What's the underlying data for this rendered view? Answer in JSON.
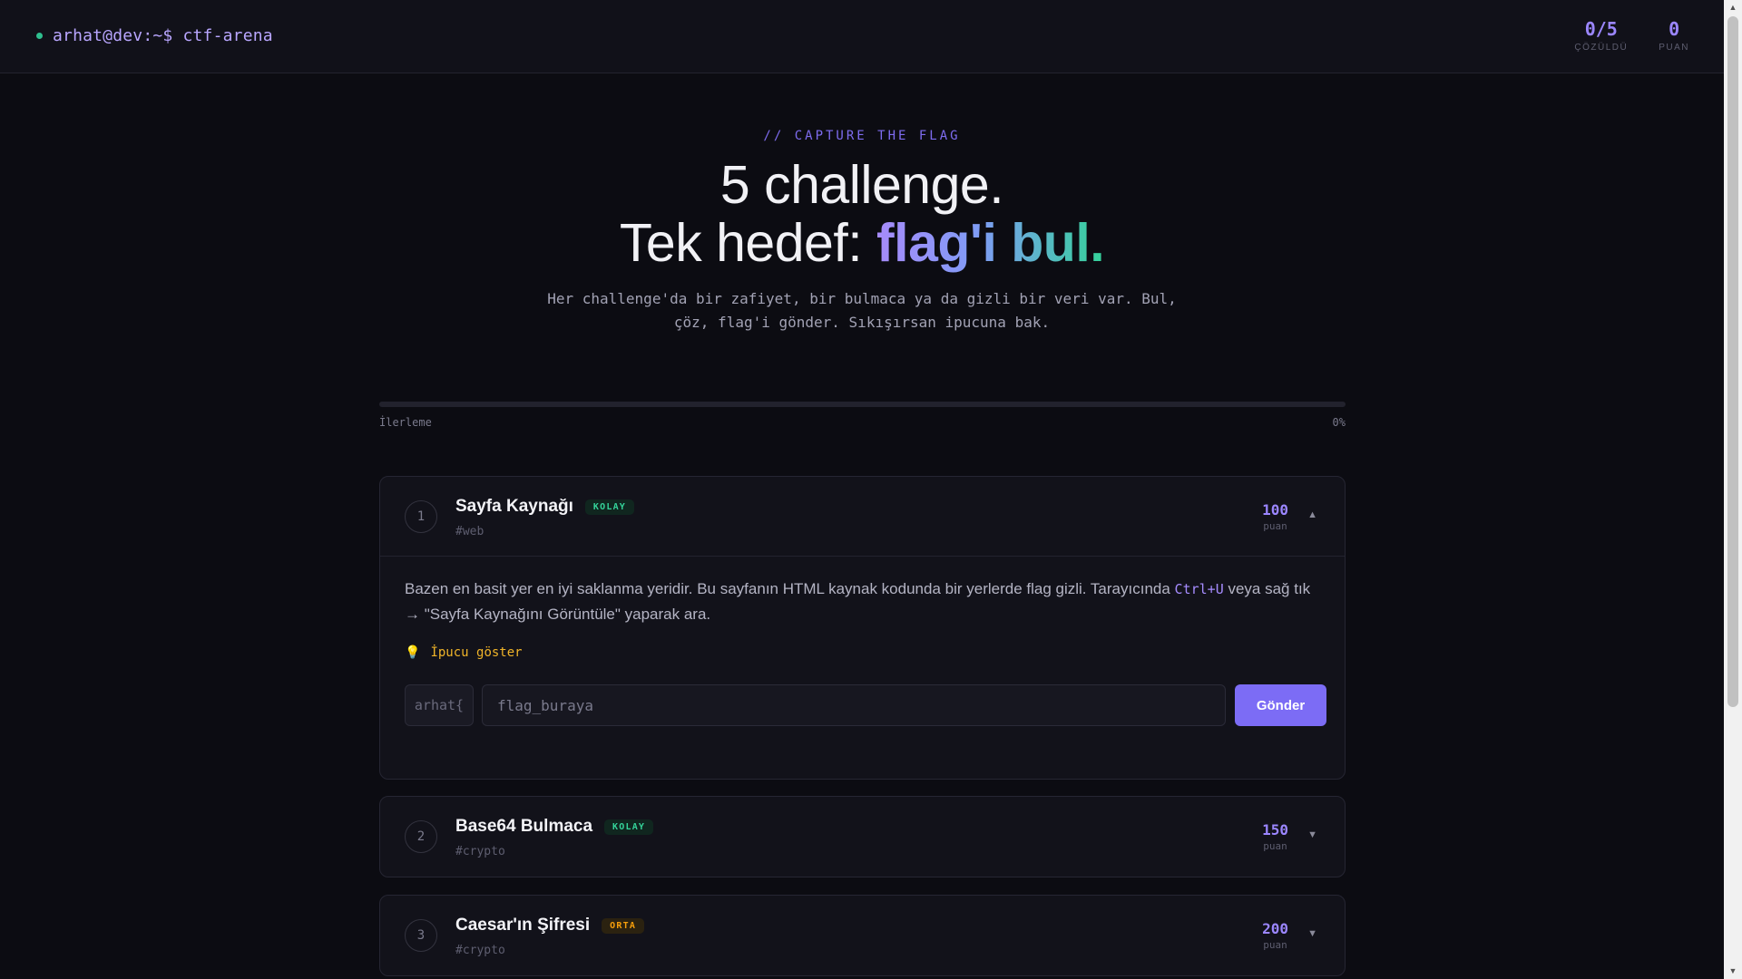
{
  "header": {
    "prompt": "arhat@dev:~$ ctf-arena",
    "stats": [
      {
        "value": "0/5",
        "label": "ÇÖZÜLDÜ"
      },
      {
        "value": "0",
        "label": "PUAN"
      }
    ]
  },
  "hero": {
    "eyebrow": "// CAPTURE THE FLAG",
    "title_line1": "5 challenge.",
    "title_line2_prefix": "Tek hedef: ",
    "title_line2_highlight": "flag'i bul.",
    "lead": "Her challenge'da bir zafiyet, bir bulmaca ya da gizli bir veri var. Bul, çöz, flag'i gönder. Sıkışırsan ipucuna bak."
  },
  "progress": {
    "label": "İlerleme",
    "percent_text": "0%",
    "fraction": 0
  },
  "challenges": [
    {
      "number": "1",
      "name": "Sayfa Kaynağı",
      "difficulty": "KOLAY",
      "tag": "#web",
      "points": "100",
      "points_label": "puan",
      "expanded": true,
      "description_before": "Bazen en basit yer en iyi saklanma yeridir. Bu sayfanın HTML kaynak kodunda bir yerlerde flag gizli. Tarayıcında ",
      "description_kbd": "Ctrl+U",
      "description_after": " veya sağ tık → \"Sayfa Kaynağını Görüntüle\" yaparak ara.",
      "hint_label": "İpucu göster",
      "flag_prefix": "arhat{",
      "flag_placeholder": "flag_buraya",
      "submit_label": "Gönder"
    },
    {
      "number": "2",
      "name": "Base64 Bulmaca",
      "difficulty": "KOLAY",
      "tag": "#crypto",
      "points": "150",
      "points_label": "puan",
      "expanded": false
    },
    {
      "number": "3",
      "name": "Caesar'ın Şifresi",
      "difficulty": "ORTA",
      "tag": "#crypto",
      "points": "200",
      "points_label": "puan",
      "expanded": false
    }
  ],
  "colors": {
    "accent": "#7c6cf5",
    "easy": "#34d399",
    "medium": "#f59e0b",
    "hint": "#f0b429"
  },
  "icons": {
    "status": "dot-icon",
    "hint": "lightbulb-icon",
    "expanded": "chevron-up-icon",
    "collapsed": "chevron-down-icon"
  }
}
